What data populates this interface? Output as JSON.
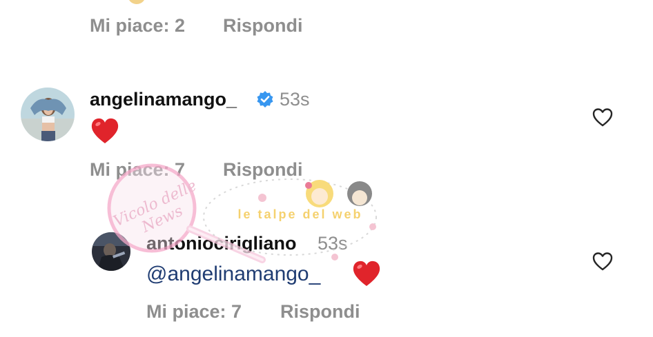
{
  "previous_comment": {
    "likes_label": "Mi piace: 2",
    "reply_label": "Rispondi"
  },
  "comment": {
    "username": "angelinamango_",
    "verified": true,
    "time": "53s",
    "text_emoji": "heart",
    "likes_label": "Mi piace: 7",
    "reply_label": "Rispondi"
  },
  "reply": {
    "username": "antoniocirigliano",
    "time": "53s",
    "mention": "@angelinamango_",
    "text_emoji": "heart",
    "likes_label": "Mi piace: 7",
    "reply_label": "Rispondi"
  },
  "watermark": {
    "text_left": "Vicolo delle News",
    "text_right": "le talpe del web"
  },
  "colors": {
    "meta_gray": "#8e8e8e",
    "verified_blue": "#3897f0",
    "heart_red": "#e0242b",
    "mention_blue": "#1f3c72"
  },
  "icons": {
    "verified": "verified-badge-icon",
    "like": "heart-outline-icon",
    "emoji": "red-heart-emoji-icon"
  }
}
